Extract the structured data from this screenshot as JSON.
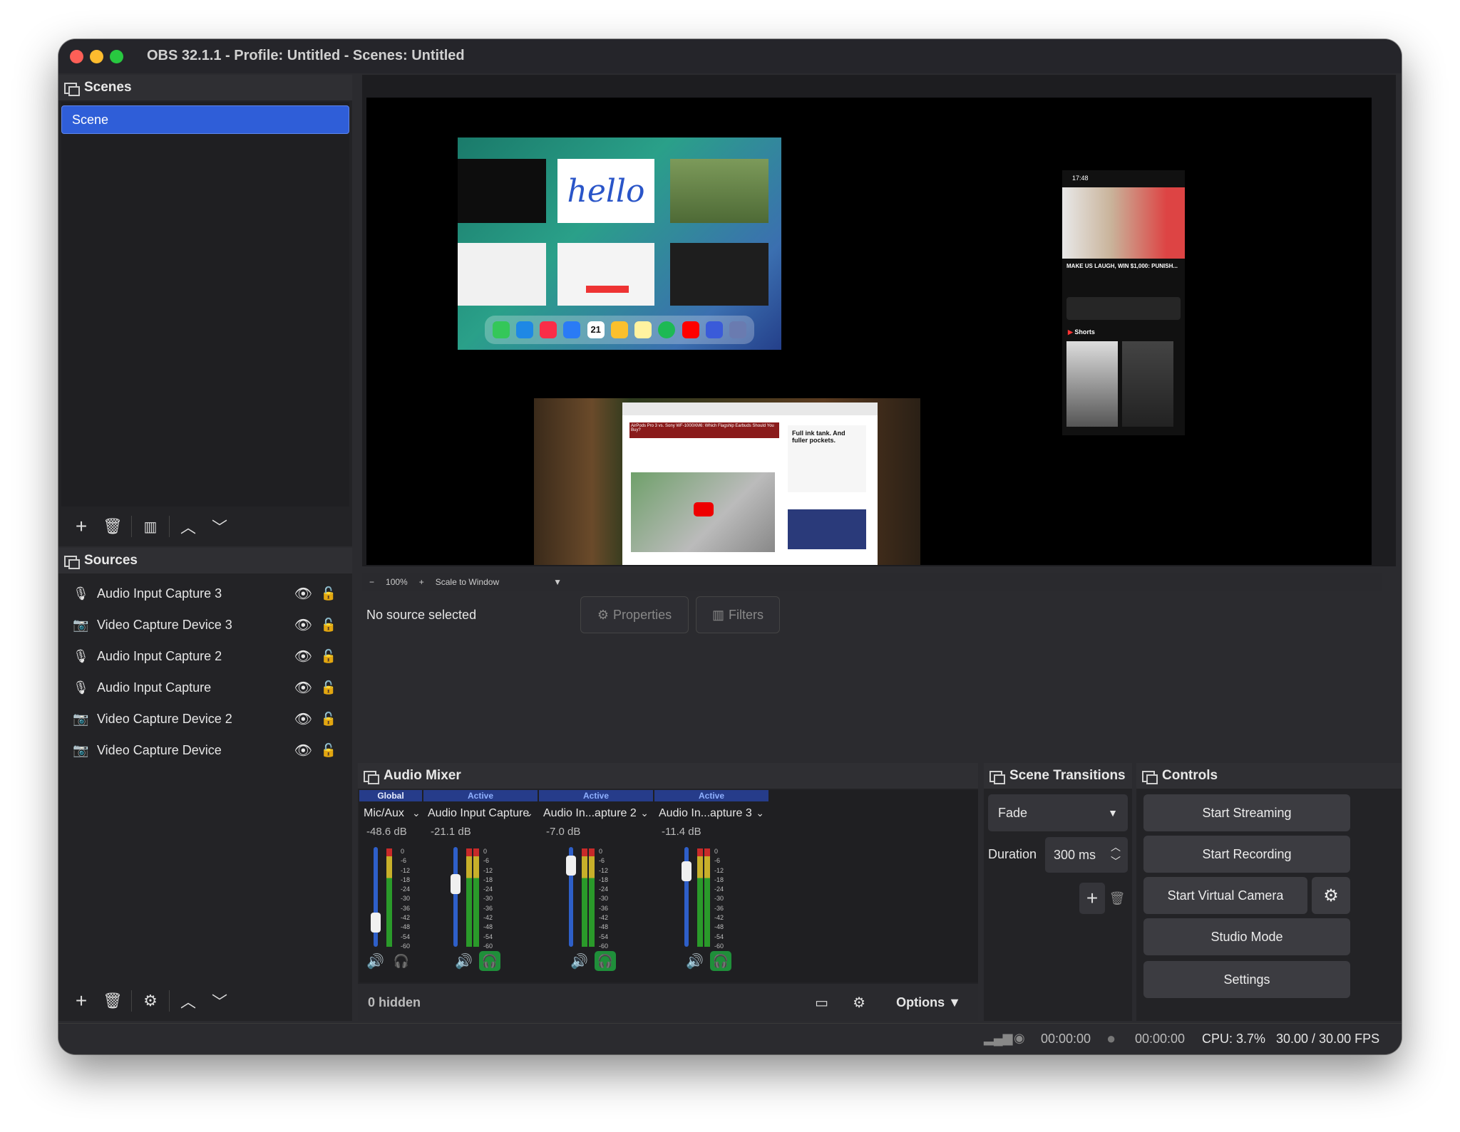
{
  "window": {
    "title": "OBS 32.1.1 - Profile: Untitled - Scenes: Untitled"
  },
  "scenes": {
    "header": "Scenes",
    "items": [
      {
        "label": "Scene"
      }
    ]
  },
  "sources": {
    "header": "Sources",
    "items": [
      {
        "label": "Audio Input Capture 3",
        "icon": "microphone-icon"
      },
      {
        "label": "Video Capture Device 3",
        "icon": "camera-icon"
      },
      {
        "label": "Audio Input Capture 2",
        "icon": "microphone-icon"
      },
      {
        "label": "Audio Input Capture",
        "icon": "microphone-icon"
      },
      {
        "label": "Video Capture Device 2",
        "icon": "camera-icon"
      },
      {
        "label": "Video Capture Device",
        "icon": "camera-icon"
      }
    ]
  },
  "preview": {
    "zoom": "100%",
    "scale_mode": "Scale to Window",
    "phone_time": "17:48",
    "video_title": "MAKE US LAUGH, WIN $1,000: PUNISH...",
    "shorts_label": "Shorts",
    "ipad_hello": "hello",
    "calendar_day": "21",
    "browser_headline": "AirPods Pro 3 vs. Sony WF-1000XM6: Which Flagship Earbuds Should You Buy?",
    "ad_text": "Full ink tank. And fuller pockets."
  },
  "sourcebar": {
    "status": "No source selected",
    "properties": "Properties",
    "filters": "Filters"
  },
  "mixer": {
    "header": "Audio Mixer",
    "hidden": "0 hidden",
    "options": "Options",
    "scale": [
      "0",
      "-6",
      "-12",
      "-18",
      "-24",
      "-30",
      "-36",
      "-42",
      "-48",
      "-54",
      "-60"
    ],
    "channels": [
      {
        "tag": "Global",
        "name": "Mic/Aux",
        "db": "-48.6 dB",
        "level": 0.1,
        "monitor": false
      },
      {
        "tag": "Active",
        "name": "Audio Input Capture",
        "db": "-21.1 dB",
        "level": 0.6,
        "monitor": true
      },
      {
        "tag": "Active",
        "name": "Audio In...apture 2",
        "db": "-7.0 dB",
        "level": 0.8,
        "monitor": true
      },
      {
        "tag": "Active",
        "name": "Audio In...apture 3",
        "db": "-11.4 dB",
        "level": 0.75,
        "monitor": true
      }
    ]
  },
  "transitions": {
    "header": "Scene Transitions",
    "type": "Fade",
    "duration_label": "Duration",
    "duration": "300 ms"
  },
  "controls": {
    "header": "Controls",
    "start_streaming": "Start Streaming",
    "start_recording": "Start Recording",
    "start_virtual_camera": "Start Virtual Camera",
    "studio_mode": "Studio Mode",
    "settings": "Settings"
  },
  "status": {
    "stream_time": "00:00:00",
    "record_time": "00:00:00",
    "cpu": "CPU: 3.7%",
    "fps": "30.00 / 30.00 FPS"
  },
  "colors": {
    "accent": "#2f5ed8",
    "meter_green": "#2a9a2a",
    "monitor_on": "#1f8f3a"
  }
}
